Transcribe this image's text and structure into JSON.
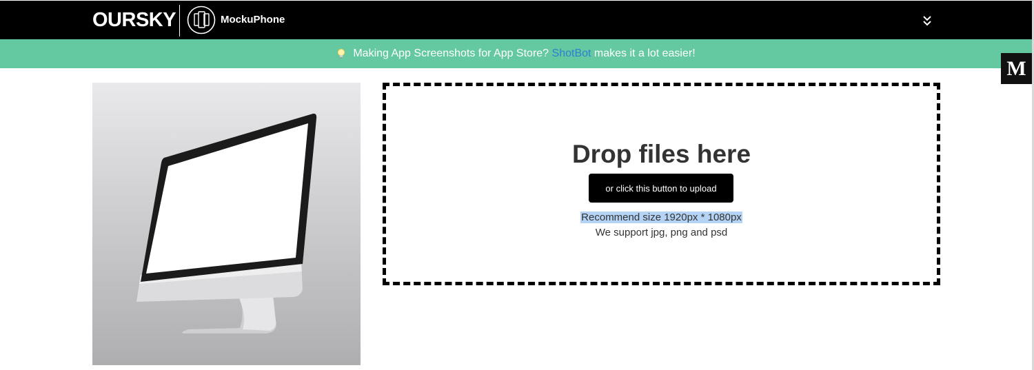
{
  "header": {
    "company": "OURSKY",
    "product": "MockuPhone",
    "menu_icon": "double-chevron-down-icon"
  },
  "promo": {
    "icon": "lightbulb-icon",
    "text_before": "Making App Screenshots for App Store?",
    "link_text": "ShotBot",
    "text_after": "makes it a lot easier!"
  },
  "medium_badge": {
    "label": "M"
  },
  "preview": {
    "device": "imac-icon"
  },
  "upload": {
    "title": "Drop files here",
    "button_label": "or click this button to upload",
    "size_note": "Recommend size 1920px * 1080px",
    "format_note": "We support jpg, png and psd"
  },
  "colors": {
    "topbar": "#000000",
    "promo_bg": "#64c9a0",
    "link": "#2d7fd3",
    "selection_highlight": "#b4d3f5"
  }
}
